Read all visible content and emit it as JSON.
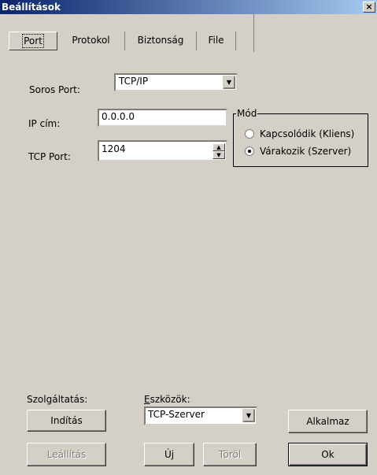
{
  "window": {
    "title": "Beállítások",
    "close_glyph": "×"
  },
  "tabs": [
    {
      "label": "Port",
      "active": true
    },
    {
      "label": "Protokol",
      "active": false
    },
    {
      "label": "Biztonság",
      "active": false
    },
    {
      "label": "File",
      "active": false
    }
  ],
  "port": {
    "serial_port_label": "Soros Port:",
    "serial_port_value": "TCP/IP",
    "ip_label": "IP cím:",
    "ip_value": "0.0.0.0",
    "tcp_port_label": "TCP Port:",
    "tcp_port_value": "1204"
  },
  "mode": {
    "legend": "Mód",
    "options": [
      {
        "label": "Kapcsolódik (Kliens)",
        "checked": false
      },
      {
        "label": "Várakozik (Szerver)",
        "checked": true
      }
    ]
  },
  "service": {
    "label": "Szolgáltatás:",
    "start_label": "Indítás",
    "stop_label": "Leállítás"
  },
  "tools": {
    "label": "Eszközök:",
    "selected": "TCP-Szerver",
    "new_label": "Új",
    "delete_label": "Töröl"
  },
  "actions": {
    "apply_label": "Alkalmaz",
    "ok_label": "Ok"
  },
  "icons": {
    "dropdown": "chevron-down-icon",
    "spinner": "up-down-spin-icon"
  }
}
